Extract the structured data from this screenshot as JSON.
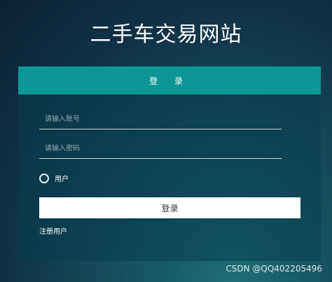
{
  "page": {
    "title": "二手车交易网站"
  },
  "login": {
    "header": "登  录",
    "account_placeholder": "请输入账号",
    "password_placeholder": "请输入密码",
    "role_label": "用户",
    "submit_label": "登录",
    "register_label": "注册用户"
  },
  "watermark": "CSDN @QQ402205496"
}
